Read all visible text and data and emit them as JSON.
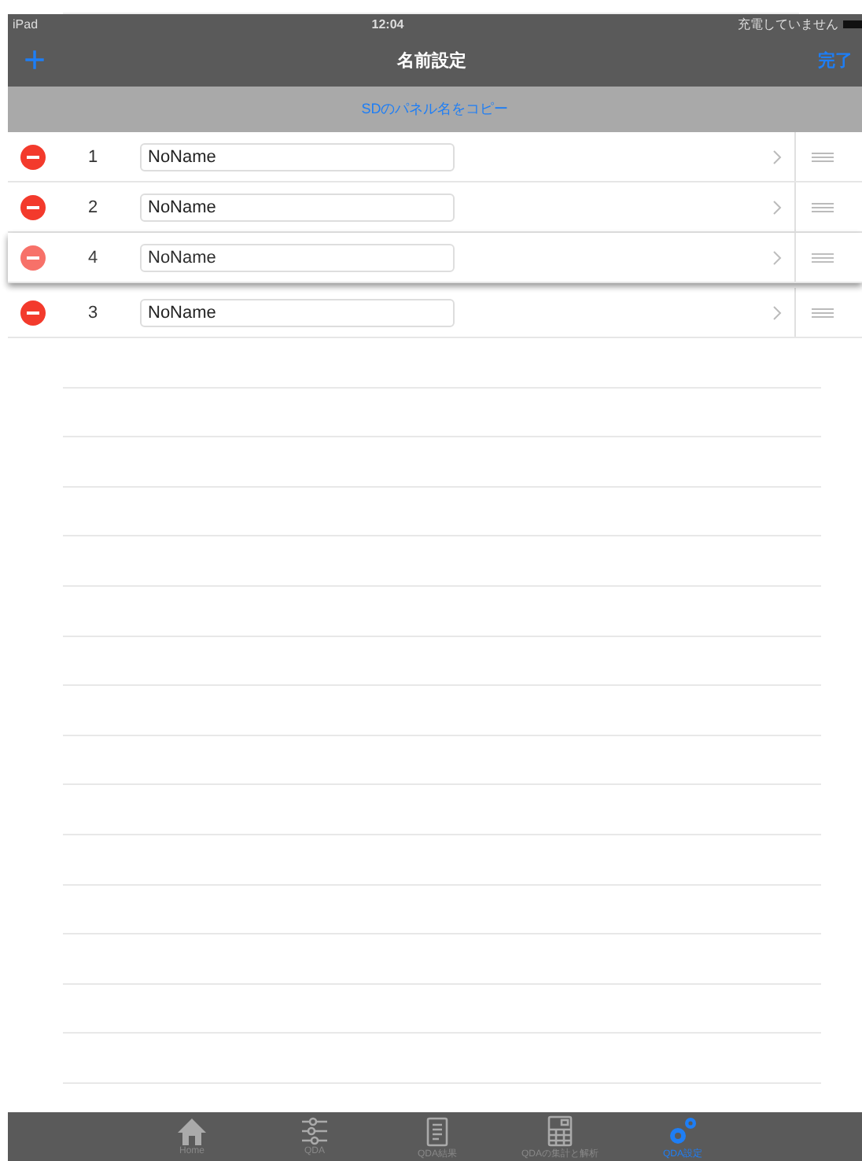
{
  "status_bar": {
    "device": "iPad",
    "time": "12:04",
    "battery_text": "充電していません"
  },
  "nav_bar": {
    "add_button": "+",
    "title": "名前設定",
    "done_button": "完了"
  },
  "copy_button": "SDのパネル名をコピー",
  "rows": [
    {
      "number": "1",
      "name": "NoName",
      "dragging": false
    },
    {
      "number": "2",
      "name": "NoName",
      "dragging": false
    },
    {
      "number": "4",
      "name": "NoName",
      "dragging": true
    },
    {
      "number": "3",
      "name": "NoName",
      "dragging": false
    }
  ],
  "tabs": [
    {
      "label": "Home",
      "kind": "home",
      "selected": false
    },
    {
      "label": "QDA",
      "kind": "sliders",
      "selected": false
    },
    {
      "label": "QDA結果",
      "kind": "document",
      "selected": false
    },
    {
      "label": "QDAの集計と解析",
      "kind": "calculator",
      "selected": false
    },
    {
      "label": "QDA設定",
      "kind": "gears",
      "selected": true
    }
  ]
}
